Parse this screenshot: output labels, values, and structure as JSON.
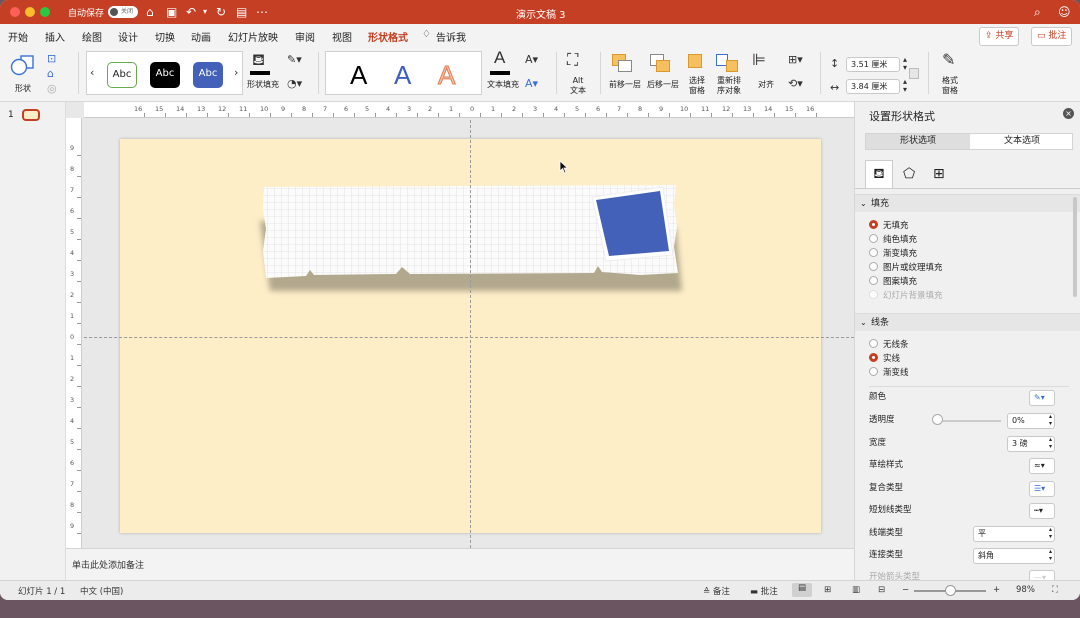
{
  "titlebar": {
    "autosave_label": "自动保存",
    "toggle_label": "关闭",
    "doc_title": "演示文稿 3",
    "accent": "#c43f23"
  },
  "menu": {
    "items": [
      "开始",
      "插入",
      "绘图",
      "设计",
      "切换",
      "动画",
      "幻灯片放映",
      "审阅",
      "视图",
      "形状格式"
    ],
    "tellme": "告诉我",
    "share": "共享",
    "comments": "批注"
  },
  "ribbon": {
    "shape_label": "形状",
    "styles": [
      "Abc",
      "Abc",
      "Abc"
    ],
    "fill_label": "形状填充",
    "wordart": [
      "A",
      "A",
      "A"
    ],
    "text_fill_label": "文本填充",
    "alt_text_label": "Alt\n文本",
    "bring_forward": "前移一层",
    "send_backward": "后移一层",
    "selection_pane": "选择\n窗格",
    "reorder": "重新排\n序对象",
    "align": "对齐",
    "height": "3.51 厘米",
    "width": "3.84 厘米",
    "format_pane": "格式\n窗格"
  },
  "thumbnails": {
    "slide_number": "1"
  },
  "ruler": {
    "h_numbers": [
      "16",
      "15",
      "14",
      "13",
      "12",
      "11",
      "10",
      "9",
      "8",
      "7",
      "6",
      "5",
      "4",
      "3",
      "2",
      "1",
      "0",
      "1",
      "2",
      "3",
      "4",
      "5",
      "6",
      "7",
      "8",
      "9",
      "10",
      "11",
      "12",
      "13",
      "14",
      "15",
      "16"
    ],
    "v_numbers": [
      "9",
      "8",
      "7",
      "6",
      "5",
      "4",
      "3",
      "2",
      "1",
      "0",
      "1",
      "2",
      "3",
      "4",
      "5",
      "6",
      "7",
      "8",
      "9"
    ]
  },
  "slide": {
    "background": "#fdeec8",
    "sticky_color": "#4361b8"
  },
  "notes": {
    "placeholder": "单击此处添加备注"
  },
  "pane": {
    "title": "设置形状格式",
    "tabs": [
      "形状选项",
      "文本选项"
    ],
    "fill_section": "填充",
    "fill_options": [
      "无填充",
      "纯色填充",
      "渐变填充",
      "图片或纹理填充",
      "图案填充",
      "幻灯片背景填充"
    ],
    "line_section": "线条",
    "line_options": [
      "无线条",
      "实线",
      "渐变线"
    ],
    "props": {
      "color": "颜色",
      "transparency": "透明度",
      "transparency_value": "0%",
      "width": "宽度",
      "width_value": "3 磅",
      "sketch": "草绘样式",
      "compound": "复合类型",
      "dash": "短划线类型",
      "cap": "线端类型",
      "cap_value": "平",
      "join": "连接类型",
      "join_value": "斜角",
      "arrow_start": "开始箭头类型"
    }
  },
  "status": {
    "slide_info": "幻灯片 1 / 1",
    "language": "中文 (中国)",
    "notes_btn": "备注",
    "comments_btn": "批注",
    "zoom": "98%"
  }
}
